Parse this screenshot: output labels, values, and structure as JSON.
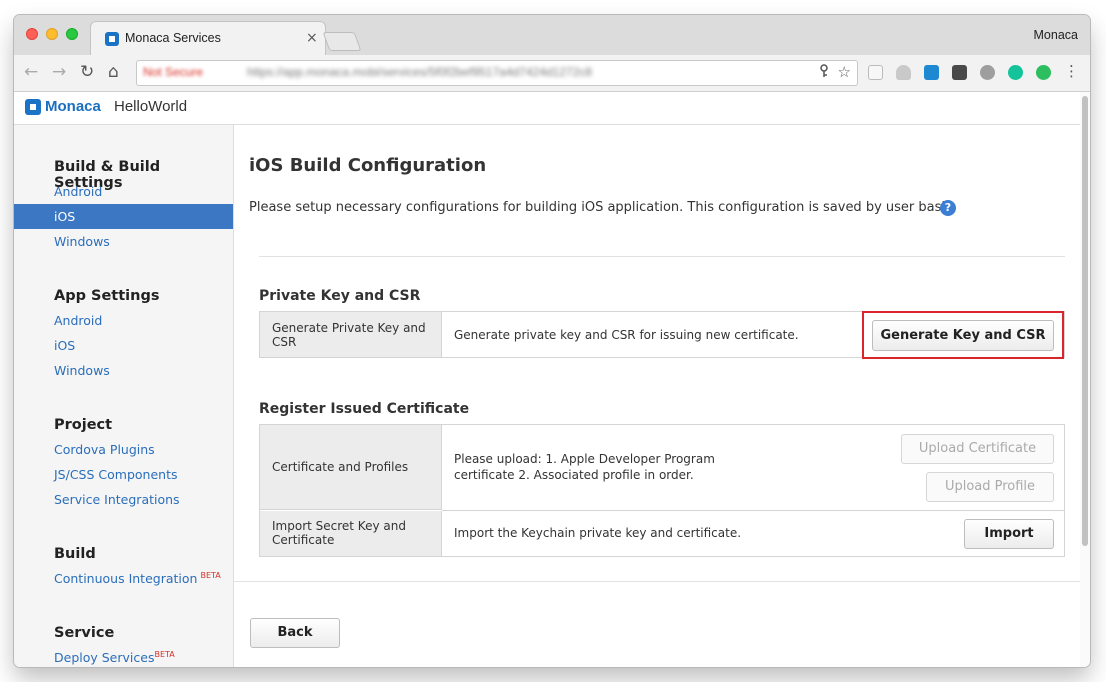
{
  "browser": {
    "tab_title": "Monaca Services",
    "tab_close": "×",
    "profile": "Monaca",
    "nav": {
      "back": "←",
      "forward": "→",
      "reload": "↻",
      "home": "⌂"
    },
    "url_security": "Not Secure",
    "url": "https://app.monaca.mobi/services/5f0f2bef9517a4d7424d1272c8",
    "key_icon": "key-icon",
    "star_icon": "★"
  },
  "app": {
    "logo": "Monaca",
    "project": "HelloWorld"
  },
  "sidebar": {
    "build_settings": {
      "heading": "Build & Build Settings",
      "items": [
        "Android",
        "iOS",
        "Windows"
      ],
      "active": "iOS"
    },
    "app_settings": {
      "heading": "App Settings",
      "items": [
        "Android",
        "iOS",
        "Windows"
      ]
    },
    "project": {
      "heading": "Project",
      "items": [
        "Cordova Plugins",
        "JS/CSS Components",
        "Service Integrations"
      ]
    },
    "build": {
      "heading": "Build",
      "ci": "Continuous Integration",
      "ci_badge": "BETA"
    },
    "service": {
      "heading": "Service",
      "deploy": "Deploy Services",
      "deploy_badge": "BETA"
    }
  },
  "main": {
    "title": "iOS Build Configuration",
    "description": "Please setup necessary configurations for building iOS application. This configuration is saved by user basis.",
    "help": "?",
    "private_key": {
      "heading": "Private Key and CSR",
      "label_line1": "Generate Private Key and",
      "label_line2": "CSR",
      "text": "Generate private key and CSR for issuing new certificate.",
      "button": "Generate Key and CSR"
    },
    "register": {
      "heading": "Register Issued Certificate",
      "cert_label": "Certificate and Profiles",
      "cert_text_line1": "Please upload: 1. Apple Developer Program",
      "cert_text_line2": "certificate  2. Associated profile  in order.",
      "upload_cert_button": "Upload Certificate",
      "upload_profile_button": "Upload Profile",
      "import_label_line1": "Import Secret Key and",
      "import_label_line2": "Certificate",
      "import_text": "Import the Keychain private key and certificate.",
      "import_button": "Import"
    },
    "back_button": "Back"
  },
  "colors": {
    "accent": "#3c77c4",
    "link": "#2a6ebb",
    "highlight": "#d9252b"
  }
}
